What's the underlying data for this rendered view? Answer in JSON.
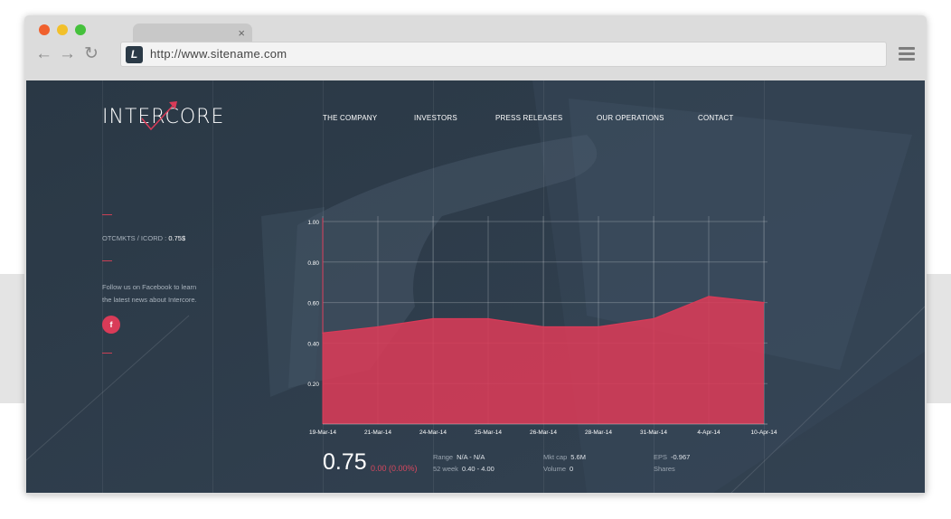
{
  "browser": {
    "tab_close": "×",
    "url": "http://www.sitename.com",
    "favicon_letter": "L",
    "back_icon": "←",
    "forward_icon": "→",
    "reload_icon": "↻"
  },
  "site": {
    "logo": "INTERCORE",
    "nav": [
      "THE COMPANY",
      "INVESTORS",
      "PRESS RELEASES",
      "OUR OPERATIONS",
      "CONTACT"
    ],
    "ticker_label": "OTCMKTS / ICORD :",
    "ticker_value": "0.75$",
    "follow_line1": "Follow us on Facebook to learn",
    "follow_line2": "the latest news about Intercore.",
    "fb_icon": "f",
    "accent": "#d93b58"
  },
  "quote": {
    "price": "0.75",
    "change": "0.00 (0.00%)",
    "range_label": "Range",
    "range_value": "N/A - N/A",
    "week52_label": "52 week",
    "week52_value": "0.40 - 4.00",
    "mktcap_label": "Mkt cap",
    "mktcap_value": "5.6M",
    "volume_label": "Volume",
    "volume_value": "0",
    "eps_label": "EPS",
    "eps_value": "-0.967",
    "shares_label": "Shares"
  },
  "chart_data": {
    "type": "area",
    "categories": [
      "19-Mar-14",
      "21-Mar-14",
      "24-Mar-14",
      "25-Mar-14",
      "26-Mar-14",
      "28-Mar-14",
      "31-Mar-14",
      "4-Apr-14",
      "10-Apr-14"
    ],
    "values": [
      0.45,
      0.48,
      0.52,
      0.52,
      0.48,
      0.48,
      0.52,
      0.63,
      0.6
    ],
    "yticks": [
      "0.20",
      "0.40",
      "0.60",
      "0.80",
      "1.00"
    ],
    "ylim": [
      0,
      1.0
    ],
    "grid": true,
    "color": "#d93b58"
  }
}
